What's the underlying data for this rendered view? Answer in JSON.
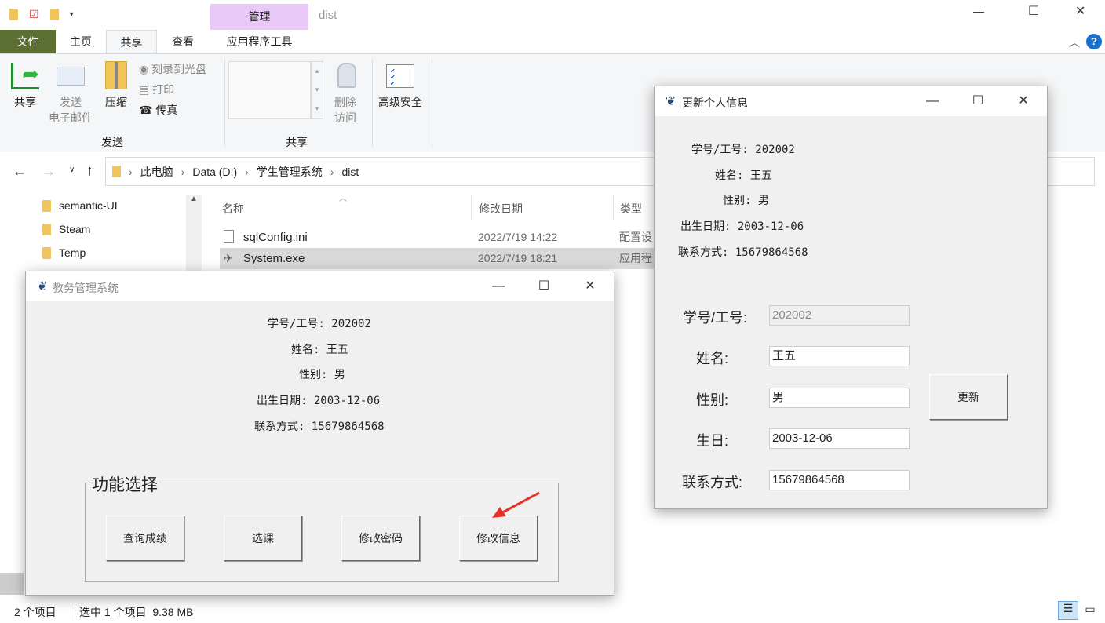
{
  "explorer": {
    "title": "dist",
    "context_tab": "管理",
    "tabs": [
      "文件",
      "主页",
      "共享",
      "查看",
      "应用程序工具"
    ],
    "ribbon": {
      "share": "共享",
      "send_email": [
        "发送",
        "电子邮件"
      ],
      "zip": "压缩",
      "burn": "刻录到光盘",
      "print": "打印",
      "fax": "传真",
      "group_send": "发送",
      "remove_access": [
        "删除",
        "访问"
      ],
      "advanced_security": "高级安全",
      "group_share": "共享"
    },
    "breadcrumb": [
      "此电脑",
      "Data (D:)",
      "学生管理系统",
      "dist"
    ],
    "nav_items": [
      "semantic-UI",
      "Steam",
      "Temp"
    ],
    "columns": [
      "名称",
      "修改日期",
      "类型"
    ],
    "files": [
      {
        "name": "sqlConfig.ini",
        "date": "2022/7/19 14:22",
        "type": "配置设"
      },
      {
        "name": "System.exe",
        "date": "2022/7/19 18:21",
        "type": "应用程"
      }
    ],
    "status": {
      "count": "2 个项目",
      "selected": "选中 1 个项目  9.38 MB"
    }
  },
  "main_window": {
    "title": "教务管理系统",
    "info": [
      "学号/工号: 202002",
      "姓名: 王五",
      "性别: 男",
      "出生日期: 2003-12-06",
      "联系方式: 15679864568"
    ],
    "group_label": "功能选择",
    "buttons": [
      "查询成绩",
      "选课",
      "修改密码",
      "修改信息"
    ]
  },
  "update_window": {
    "title": "更新个人信息",
    "info": [
      "学号/工号: 202002",
      "姓名: 王五",
      "性别: 男",
      "出生日期: 2003-12-06",
      "联系方式: 15679864568"
    ],
    "fields": [
      {
        "label": "学号/工号:",
        "value": "202002",
        "disabled": true
      },
      {
        "label": "姓名:",
        "value": "王五"
      },
      {
        "label": "性别:",
        "value": "男"
      },
      {
        "label": "生日:",
        "value": "2003-12-06"
      },
      {
        "label": "联系方式:",
        "value": "15679864568"
      }
    ],
    "update_button": "更新"
  },
  "colors": {
    "file_tab": "#5c6f33",
    "context_tab": "#e9c9f7",
    "arrow": "#e8302b"
  }
}
